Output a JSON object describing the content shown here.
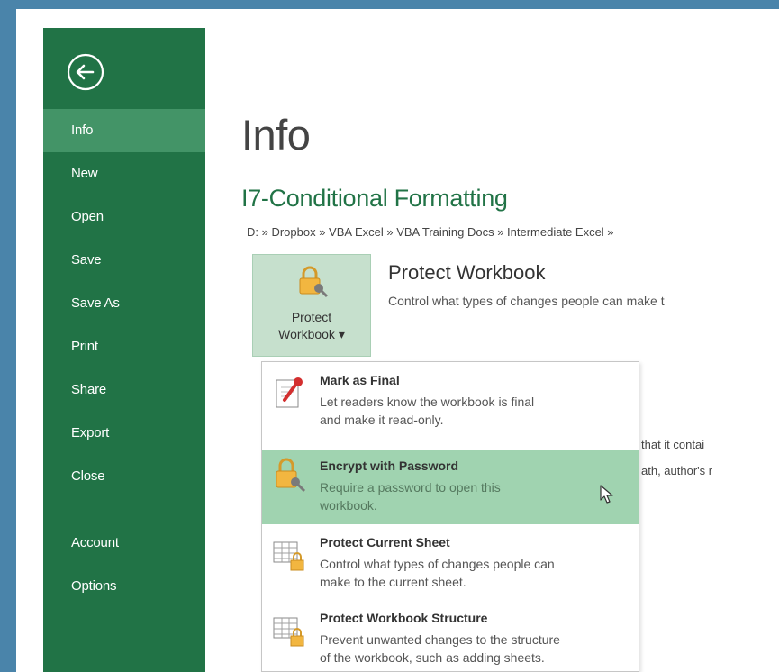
{
  "nav": {
    "back_icon": "back-arrow-icon",
    "items": [
      {
        "label": "Info",
        "active": true
      },
      {
        "label": "New"
      },
      {
        "label": "Open"
      },
      {
        "label": "Save"
      },
      {
        "label": "Save As"
      },
      {
        "label": "Print"
      },
      {
        "label": "Share"
      },
      {
        "label": "Export"
      },
      {
        "label": "Close"
      }
    ],
    "bottom_items": [
      {
        "label": "Account"
      },
      {
        "label": "Options"
      }
    ]
  },
  "main": {
    "title": "Info",
    "file_name": "I7-Conditional Formatting",
    "path": "D: » Dropbox » VBA Excel » VBA Training Docs » Intermediate Excel »",
    "protect_button": {
      "line1": "Protect",
      "line2": "Workbook ▾"
    },
    "protect_section": {
      "heading": "Protect Workbook",
      "description": "Control what types of changes people can make t"
    },
    "behind_text": {
      "line1": "that it contai",
      "line2": "ath, author's r"
    }
  },
  "dropdown": {
    "items": [
      {
        "icon": "mark-final-icon",
        "title": "Mark as Final",
        "desc1": "Let readers know the workbook is final",
        "desc2": "and make it read-only."
      },
      {
        "icon": "lock-key-icon",
        "title": "Encrypt with Password",
        "desc1": "Require a password to open this",
        "desc2": "workbook.",
        "highlighted": true
      },
      {
        "icon": "sheet-lock-icon",
        "title": "Protect Current Sheet",
        "desc1": "Control what types of changes people can",
        "desc2": "make to the current sheet."
      },
      {
        "icon": "structure-lock-icon",
        "title": "Protect Workbook Structure",
        "desc1": "Prevent unwanted changes to the structure",
        "desc2": "of the workbook, such as adding sheets."
      }
    ]
  },
  "colors": {
    "sidebar": "#217346",
    "sidebar_active": "#439467",
    "accent": "#217346",
    "highlight": "#a0d3b0",
    "backdrop": "#4a84aa"
  }
}
